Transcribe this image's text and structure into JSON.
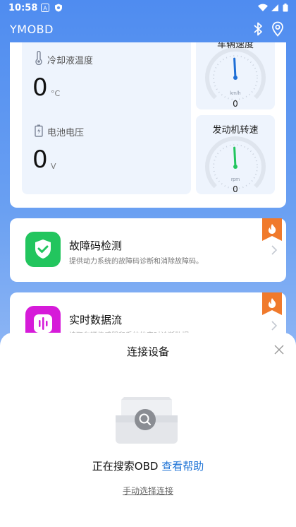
{
  "status_bar": {
    "time": "10:58"
  },
  "app_bar": {
    "title": "YMOBD"
  },
  "dashboard": {
    "coolant": {
      "label": "冷却液温度",
      "value": "0",
      "unit": "°C"
    },
    "battery": {
      "label": "电池电压",
      "value": "0",
      "unit": "V"
    },
    "speed_gauge": {
      "title": "车辆速度",
      "unit": "km/h",
      "value": "0"
    },
    "rpm_gauge": {
      "title": "发动机转速",
      "unit": "rpm",
      "value": "0"
    }
  },
  "features": [
    {
      "title": "故障码检测",
      "desc": "提供动力系统的故障码诊断和消除故障码。",
      "icon": "shield-check-icon",
      "color": "#22c55e"
    },
    {
      "title": "实时数据流",
      "desc": "读取车辆传感器和系统的实时诊断数据。",
      "icon": "waveform-icon",
      "color": "#d61bd9"
    }
  ],
  "colors": {
    "primary": "#4f8cf0",
    "ribbon": "#f07a2c",
    "needle_speed": "#1f6fd6",
    "needle_rpm": "#22c55e",
    "link": "#1f74d6"
  },
  "sheet": {
    "title": "连接设备",
    "status_text": "正在搜索OBD",
    "help_link": "查看帮助",
    "manual_link": "手动选择连接"
  }
}
